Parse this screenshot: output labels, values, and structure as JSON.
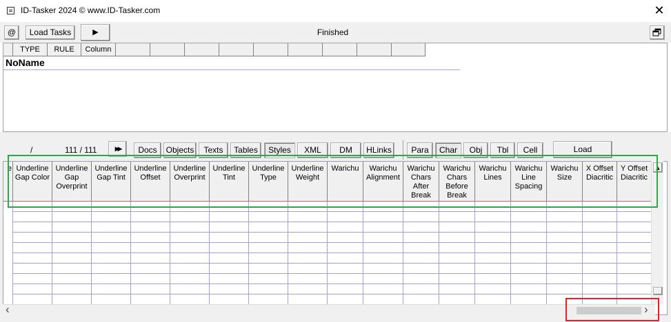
{
  "window": {
    "title": "ID-Tasker 2024  © www.ID-Tasker.com",
    "close_glyph": "✕"
  },
  "toolbar": {
    "at_label": "@",
    "load_tasks_label": "Load Tasks",
    "run_glyph": "▶",
    "status": "Finished",
    "restore_icon": "window-restore-icon"
  },
  "upper_table": {
    "columns": [
      "TYPE",
      "RULE",
      "Column",
      "",
      "",
      "",
      "",
      "",
      "",
      "",
      "",
      ""
    ],
    "row_label": "NoName"
  },
  "nav": {
    "slash": "/",
    "counter": "111 / 111",
    "forward_glyph": "▶▶"
  },
  "tabs": [
    "Docs",
    "Objects",
    "Texts",
    "Tables",
    "Styles",
    "XML",
    "DM",
    "HLinks"
  ],
  "subtabs": [
    "Para",
    "Char",
    "Obj",
    "Tbl",
    "Cell"
  ],
  "load_label": "Load",
  "grid": {
    "row_header": "e",
    "columns": [
      "Underline Gap Color",
      "Underline Gap Overprint",
      "Underline Gap Tint",
      "Underline Offset",
      "Underline Overprint",
      "Underline Tint",
      "Underline Type",
      "Underline Weight",
      "Warichu",
      "Warichu Alignment",
      "Warichu Chars After Break",
      "Warichu Chars Before Break",
      "Warichu Lines",
      "Warichu Line Spacing",
      "Warichu Size",
      "X Offset Diacritic",
      "Y Offset Diacritic"
    ]
  },
  "scroll": {
    "up": "▲",
    "left": "‹",
    "right": "›"
  },
  "colors": {
    "highlight_green": "#2aa84a",
    "highlight_red": "#e0202a"
  }
}
